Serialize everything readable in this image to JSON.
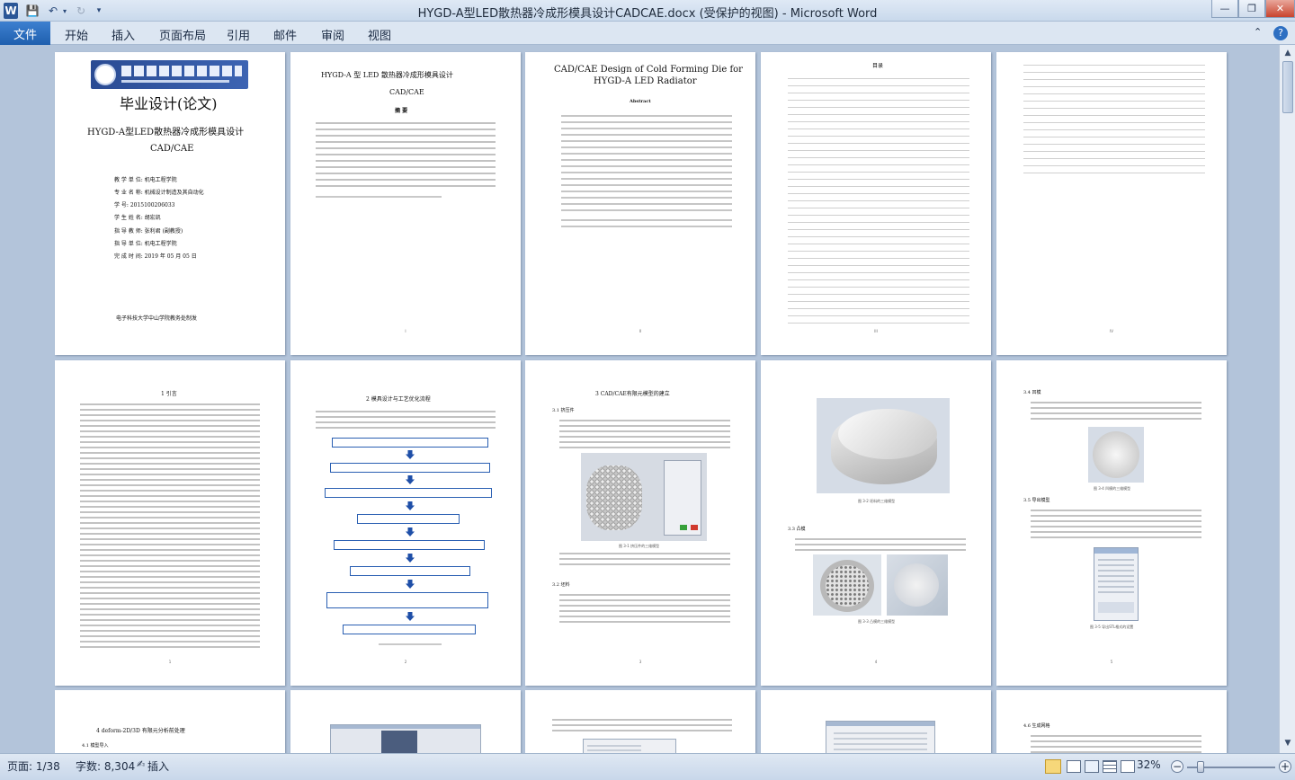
{
  "window": {
    "title": "HYGD-A型LED散热器冷成形模具设计CADCAE.docx (受保护的视图) - Microsoft Word"
  },
  "ribbon": {
    "file": "文件",
    "tabs": [
      "开始",
      "插入",
      "页面布局",
      "引用",
      "邮件",
      "审阅",
      "视图"
    ]
  },
  "pages": {
    "p1": {
      "title": "毕业设计(论文)",
      "subtitle1": "HYGD-A型LED散热器冷成形模具设计",
      "subtitle2": "CAD/CAE",
      "info": [
        "教 学 单 位: 机电工程学院",
        "专 业 名 称: 机械设计制造及其自动化",
        "学    号: 2015100206033",
        "学 生 姓 名: 胡宏凯",
        "指 导 教 师: 张利君 (副教授)",
        "指 导 单 位: 机电工程学院",
        "完 成 时 间: 2019 年 05 月 05 日"
      ],
      "footer": "电子科技大学中山学院教务处制发"
    },
    "p2": {
      "title1": "HYGD-A 型 LED 散热器冷成形模具设计",
      "title2": "CAD/CAE",
      "abstract": "摘  要"
    },
    "p3": {
      "title1": "CAD/CAE Design of Cold Forming Die for",
      "title2": "HYGD-A LED Radiator",
      "abstract": "Abstract"
    },
    "p4": {
      "toc": "目录"
    },
    "p6": {
      "heading": "1 引言"
    },
    "p7": {
      "heading": "2 模具设计与工艺优化流程"
    },
    "p8": {
      "heading": "3   CAD/CAE有限元模型的建立",
      "s1": "3.1 挤压件",
      "s2": "3.2 坯料",
      "fig": "图 3-1 挤压件的三维模型"
    },
    "p9": {
      "s3": "3.3 凸模",
      "fig1": "图 3-2 坯料的三维模型",
      "fig2": "图 3-3 凸模的三维模型"
    },
    "p10": {
      "s4": "3.4 凹模",
      "s5": "3.5 导出模型",
      "fig1": "图 3-4 凹模的三维模型",
      "fig2": "图 3-5 导出STL格式的设置"
    },
    "p11": {
      "heading": "4 deform-2D/3D 有限元分析前处理",
      "s1": "4.1 模型导入"
    },
    "p15": {
      "s1": "4.6 生成网格"
    }
  },
  "status": {
    "page": "页面: 1/38",
    "words": "字数: 8,304",
    "mode": "插入",
    "zoom": "32%"
  }
}
